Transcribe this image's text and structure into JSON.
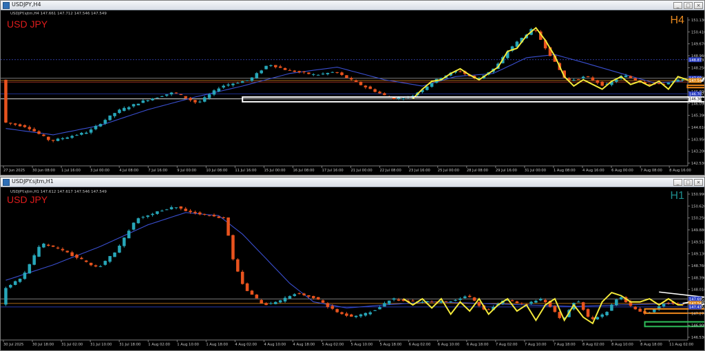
{
  "top_window": {
    "title": "USDJPY,H4",
    "info": "USDJPY.sjtm,H4  147.661 147.712 147.546 147.549",
    "symbol_label": "USD JPY",
    "timeframe_label": "H4",
    "timeframe_color": "#e8891f",
    "buttons": [
      "_",
      "□",
      "×"
    ]
  },
  "bottom_window": {
    "title": "USDJPY.sjtm,H1",
    "info": "USDJPY.sjtm,H1  147.612 147.617 147.546 147.549",
    "symbol_label": "USD JPY",
    "timeframe_label": "H1",
    "timeframe_color": "#1e8c8c",
    "buttons": [
      "_",
      "□",
      "×"
    ]
  },
  "colors": {
    "bull": "#27a6b8",
    "bear": "#e8531e",
    "ma": "#3a4fd0",
    "zigzag": "#f4ea3a",
    "projection": "#ffffff",
    "box_white": "#ffffff",
    "box_orange": "#f08a1c",
    "box_green": "#2fbf5a"
  },
  "chart_data": [
    {
      "type": "candlestick",
      "title": "USDJPY.sjtm,H4",
      "x_tick_labels": [
        "27 Jun 2025",
        "30 Jun 08:00",
        "1 Jul 16:00",
        "3 Jul 00:00",
        "4 Jul 08:00",
        "7 Jul 16:00",
        "9 Jul 00:00",
        "10 Jul 08:00",
        "11 Jul 16:00",
        "15 Jul 00:00",
        "16 Jul 08:00",
        "17 Jul 16:00",
        "21 Jul 00:00",
        "22 Jul 08:00",
        "23 Jul 16:00",
        "25 Jul 00:00",
        "28 Jul 08:00",
        "29 Jul 16:00",
        "31 Jul 00:00",
        "1 Aug 08:00",
        "4 Aug 16:00",
        "6 Aug 00:00",
        "7 Aug 08:00",
        "8 Aug 16:00"
      ],
      "y_tick_labels": [
        "151.130",
        "150.410",
        "149.670",
        "148.960",
        "148.250",
        "147.520",
        "146.800",
        "146.090",
        "145.390",
        "144.610",
        "143.950",
        "143.200",
        "142.530"
      ],
      "price_labels": [
        {
          "text": "148.873",
          "color": "#2b3fc4"
        },
        {
          "text": "147.695",
          "color": "#2b3fc4"
        },
        {
          "text": "147.549",
          "color": "#e08a1c"
        },
        {
          "text": "146.707",
          "color": "#2b3fc4"
        },
        {
          "text": "146.383",
          "color": "#ffffff"
        }
      ],
      "ylim": [
        142.3,
        151.4
      ],
      "hlines": [
        {
          "y": 148.873,
          "color": "#3d4bd0",
          "dash": true
        },
        {
          "y": 147.695,
          "color": "#8a8a8a"
        },
        {
          "y": 147.549,
          "color": "#e08a1c"
        },
        {
          "y": 147.45,
          "color": "#c0392b"
        },
        {
          "y": 146.707,
          "color": "#2b3fc4"
        },
        {
          "y": 146.383,
          "color": "#ffffff"
        }
      ],
      "anchors": [
        [
          0,
          144.9
        ],
        [
          5,
          144.6
        ],
        [
          10,
          143.7
        ],
        [
          14,
          144.0
        ],
        [
          18,
          144.3
        ],
        [
          24,
          145.6
        ],
        [
          30,
          146.3
        ],
        [
          36,
          146.8
        ],
        [
          41,
          146.1
        ],
        [
          46,
          147.2
        ],
        [
          52,
          147.6
        ],
        [
          56,
          148.6
        ],
        [
          60,
          148.2
        ],
        [
          66,
          147.9
        ],
        [
          70,
          148.1
        ],
        [
          76,
          147.2
        ],
        [
          82,
          146.4
        ],
        [
          86,
          146.5
        ],
        [
          88,
          146.9
        ],
        [
          92,
          147.7
        ],
        [
          96,
          148.2
        ],
        [
          100,
          147.6
        ],
        [
          104,
          148.4
        ],
        [
          107,
          149.6
        ],
        [
          112,
          150.9
        ],
        [
          115,
          149.4
        ],
        [
          119,
          147.5
        ],
        [
          123,
          147.8
        ],
        [
          127,
          147.2
        ],
        [
          131,
          147.9
        ],
        [
          135,
          147.4
        ],
        [
          139,
          147.3
        ],
        [
          143,
          147.6
        ]
      ],
      "ma_anchors": [
        [
          0,
          144.5
        ],
        [
          10,
          144.1
        ],
        [
          20,
          144.7
        ],
        [
          30,
          145.7
        ],
        [
          40,
          146.5
        ],
        [
          50,
          147.2
        ],
        [
          60,
          148.0
        ],
        [
          70,
          148.4
        ],
        [
          80,
          147.6
        ],
        [
          88,
          147.2
        ],
        [
          95,
          147.8
        ],
        [
          103,
          148.0
        ],
        [
          110,
          149.0
        ],
        [
          116,
          149.2
        ],
        [
          122,
          148.7
        ],
        [
          130,
          148.0
        ],
        [
          137,
          147.4
        ],
        [
          143,
          147.5
        ]
      ],
      "zigzag": [
        [
          86,
          146.4
        ],
        [
          88,
          147.0
        ],
        [
          90,
          147.5
        ],
        [
          92,
          147.6
        ],
        [
          94,
          148.0
        ],
        [
          96,
          148.3
        ],
        [
          98,
          147.9
        ],
        [
          100,
          147.6
        ],
        [
          102,
          148.0
        ],
        [
          104,
          148.4
        ],
        [
          106,
          149.4
        ],
        [
          108,
          149.6
        ],
        [
          110,
          150.4
        ],
        [
          112,
          150.9
        ],
        [
          114,
          150.1
        ],
        [
          116,
          149.1
        ],
        [
          118,
          147.8
        ],
        [
          120,
          147.2
        ],
        [
          122,
          147.6
        ],
        [
          124,
          147.3
        ],
        [
          126,
          147.0
        ],
        [
          128,
          147.5
        ],
        [
          130,
          147.8
        ],
        [
          132,
          147.3
        ],
        [
          134,
          147.5
        ],
        [
          136,
          147.2
        ],
        [
          138,
          147.5
        ],
        [
          140,
          147.0
        ],
        [
          142,
          147.8
        ],
        [
          144,
          147.6
        ],
        [
          145,
          147.5
        ]
      ],
      "projection": [
        [
          145,
          147.5
        ],
        [
          147,
          147.5
        ],
        [
          148,
          147.9
        ],
        [
          150,
          148.4
        ]
      ],
      "boxes": [
        {
          "x0": 50,
          "x1": 179,
          "y0": 146.2,
          "y1": 146.5,
          "color": "#ffffff"
        },
        {
          "x0": 144,
          "x1": 158,
          "y0": 147.1,
          "y1": 147.25,
          "color": "#f08a1c"
        }
      ]
    },
    {
      "type": "candlestick",
      "title": "USDJPY.sjtm,H1",
      "x_tick_labels": [
        "30 Jul 2025",
        "30 Jul 18:00",
        "31 Jul 02:00",
        "31 Jul 10:00",
        "31 Jul 18:00",
        "1 Aug 02:00",
        "1 Aug 10:00",
        "1 Aug 18:00",
        "4 Aug 02:00",
        "4 Aug 10:00",
        "4 Aug 18:00",
        "5 Aug 02:00",
        "5 Aug 10:00",
        "5 Aug 18:00",
        "6 Aug 02:00",
        "6 Aug 10:00",
        "6 Aug 18:00",
        "7 Aug 02:00",
        "7 Aug 10:00",
        "7 Aug 18:00",
        "8 Aug 02:00",
        "8 Aug 10:00",
        "8 Aug 18:00",
        "11 Aug 02:00"
      ],
      "y_tick_labels": [
        "150.990",
        "150.620",
        "150.250",
        "149.880",
        "149.510",
        "149.130",
        "148.760",
        "148.390",
        "148.010",
        "147.640",
        "147.270",
        "146.900",
        "146.530"
      ],
      "price_labels": [
        {
          "text": "147.695",
          "color": "#2b3fc4"
        },
        {
          "text": "147.549",
          "color": "#e08a1c"
        },
        {
          "text": "147.435",
          "color": "#2b3fc4"
        }
      ],
      "ylim": [
        146.45,
        151.1
      ],
      "hlines": [
        {
          "y": 147.695,
          "color": "#8a8a8a"
        },
        {
          "y": 147.549,
          "color": "#e08a1c"
        },
        {
          "y": 147.435,
          "color": "#2b3fc4"
        }
      ],
      "anchors": [
        [
          0,
          148.0
        ],
        [
          4,
          148.4
        ],
        [
          8,
          149.5
        ],
        [
          12,
          149.3
        ],
        [
          16,
          149.0
        ],
        [
          20,
          148.7
        ],
        [
          24,
          149.3
        ],
        [
          28,
          150.3
        ],
        [
          32,
          150.5
        ],
        [
          36,
          150.7
        ],
        [
          40,
          150.5
        ],
        [
          44,
          150.4
        ],
        [
          47,
          150.3
        ],
        [
          48,
          149.2
        ],
        [
          51,
          148.0
        ],
        [
          55,
          147.5
        ],
        [
          58,
          147.6
        ],
        [
          62,
          147.9
        ],
        [
          66,
          147.7
        ],
        [
          70,
          147.3
        ],
        [
          74,
          147.1
        ],
        [
          78,
          147.3
        ],
        [
          82,
          147.7
        ],
        [
          86,
          147.6
        ],
        [
          90,
          147.6
        ],
        [
          94,
          147.6
        ],
        [
          98,
          147.8
        ],
        [
          102,
          147.3
        ],
        [
          106,
          147.7
        ],
        [
          110,
          147.5
        ],
        [
          114,
          147.7
        ],
        [
          118,
          147.0
        ],
        [
          121,
          147.7
        ],
        [
          124,
          147.0
        ],
        [
          127,
          147.2
        ],
        [
          130,
          147.8
        ],
        [
          133,
          147.4
        ],
        [
          136,
          147.2
        ],
        [
          140,
          147.6
        ],
        [
          143,
          147.5
        ]
      ],
      "ma_anchors": [
        [
          0,
          148.3
        ],
        [
          10,
          148.8
        ],
        [
          20,
          149.4
        ],
        [
          30,
          150.1
        ],
        [
          38,
          150.5
        ],
        [
          45,
          150.4
        ],
        [
          50,
          149.8
        ],
        [
          55,
          149.0
        ],
        [
          60,
          148.2
        ],
        [
          65,
          147.6
        ],
        [
          72,
          147.4
        ],
        [
          80,
          147.5
        ],
        [
          90,
          147.6
        ],
        [
          100,
          147.55
        ],
        [
          110,
          147.5
        ],
        [
          120,
          147.45
        ],
        [
          130,
          147.5
        ],
        [
          143,
          147.55
        ]
      ],
      "zigzag": [
        [
          84,
          147.7
        ],
        [
          86,
          147.5
        ],
        [
          88,
          147.7
        ],
        [
          90,
          147.4
        ],
        [
          92,
          147.7
        ],
        [
          94,
          147.2
        ],
        [
          96,
          147.6
        ],
        [
          98,
          147.3
        ],
        [
          100,
          147.7
        ],
        [
          102,
          147.2
        ],
        [
          104,
          147.5
        ],
        [
          106,
          147.7
        ],
        [
          108,
          147.3
        ],
        [
          110,
          147.5
        ],
        [
          112,
          147.0
        ],
        [
          114,
          147.5
        ],
        [
          116,
          147.7
        ],
        [
          118,
          147.0
        ],
        [
          120,
          147.5
        ],
        [
          122,
          147.1
        ],
        [
          124,
          146.9
        ],
        [
          126,
          147.6
        ],
        [
          128,
          147.9
        ],
        [
          130,
          147.8
        ],
        [
          132,
          147.6
        ],
        [
          134,
          147.6
        ],
        [
          136,
          147.7
        ],
        [
          138,
          147.5
        ],
        [
          140,
          147.7
        ],
        [
          142,
          147.5
        ],
        [
          143,
          147.5
        ]
      ],
      "projection": [
        [
          143,
          147.55
        ],
        [
          145,
          147.6
        ],
        [
          146,
          147.5
        ],
        [
          147,
          147.5
        ],
        [
          149,
          147.6
        ],
        [
          151,
          147.7
        ],
        [
          153,
          148.1
        ],
        [
          154,
          148.3
        ],
        [
          155,
          148.7
        ]
      ],
      "trendline": [
        [
          138,
          147.92
        ],
        [
          165,
          147.45
        ]
      ],
      "boxes": [
        {
          "x0": 135,
          "x1": 156,
          "y0": 147.23,
          "y1": 147.37,
          "color": "#f08a1c"
        },
        {
          "x0": 135,
          "x1": 157,
          "y0": 146.8,
          "y1": 146.95,
          "color": "#2fbf5a"
        }
      ]
    }
  ]
}
